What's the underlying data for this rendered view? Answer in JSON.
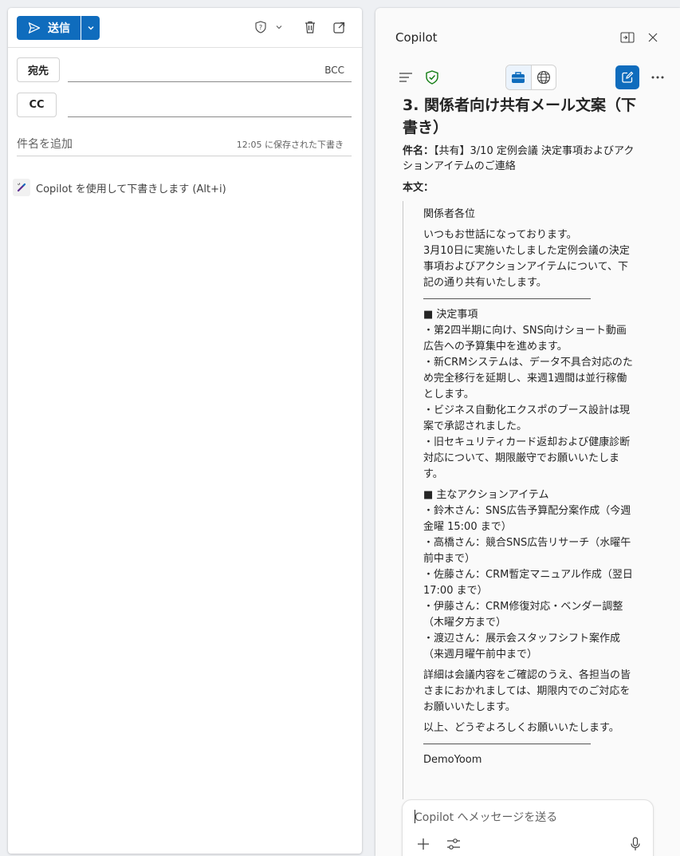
{
  "compose": {
    "send_label": "送信",
    "to_label": "宛先",
    "cc_label": "CC",
    "bcc_label": "BCC",
    "subject_placeholder": "件名を追加",
    "saved_status": "12:05 に保存された下書き",
    "copilot_hint": "Copilot を使用して下書きします (Alt+i)"
  },
  "copilot": {
    "title": "Copilot",
    "heading": "3. 関係者向け共有メール文案（下書き）",
    "subject_label": "件名：",
    "subject_value": "【共有】3/10 定例会議 決定事項およびアクションアイテムのご連絡",
    "body_label": "本文：",
    "body": {
      "greeting": "関係者各位",
      "intro": "いつもお世話になっております。\n3月10日に実施いたしました定例会議の決定事項およびアクションアイテムについて、下記の通り共有いたします。",
      "decisions_heading": "■ 決定事項",
      "decisions": "・第2四半期に向け、SNS向けショート動画広告への予算集中を進めます。\n・新CRMシステムは、データ不具合対応のため完全移行を延期し、来週1週間は並行稼働とします。\n・ビジネス自動化エクスポのブース設計は現案で承認されました。\n・旧セキュリティカード返却および健康診断対応について、期限厳守でお願いいたします。",
      "actions_heading": "■ 主なアクションアイテム",
      "actions": "・鈴木さん：SNS広告予算配分案作成（今週金曜 15:00 まで）\n・高橋さん：競合SNS広告リサーチ（水曜午前中まで）\n・佐藤さん：CRM暫定マニュアル作成（翌日 17:00 まで）\n・伊藤さん：CRM修復対応・ベンダー調整（木曜夕方まで）\n・渡辺さん：展示会スタッフシフト案作成（来週月曜午前中まで）",
      "closing1": "詳細は会議内容をご確認のうえ、各担当の皆さまにおかれましては、期限内でのご対応をお願いいたします。",
      "closing2": "以上、どうぞよろしくお願いいたします。",
      "signature": "DemoYoom"
    },
    "input_placeholder": "Copilot へメッセージを送る"
  },
  "colors": {
    "accent": "#0f6cbd",
    "shield": "#107c10"
  }
}
